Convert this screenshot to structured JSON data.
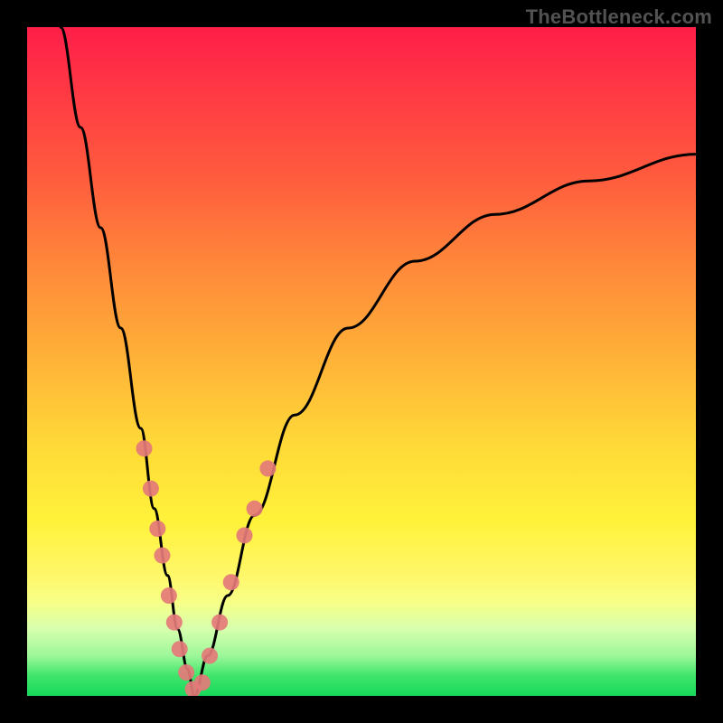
{
  "watermark": "TheBottleneck.com",
  "colors": {
    "gradient_top": "#ff1e49",
    "gradient_mid": "#ffd838",
    "gradient_bottom": "#16d95b",
    "curve": "#000000",
    "marker_fill": "#e47a7a",
    "marker_stroke": "#d46666"
  },
  "chart_data": {
    "type": "line",
    "title": "",
    "xlabel": "",
    "ylabel": "",
    "ylim": [
      0,
      100
    ],
    "xlim": [
      0,
      100
    ],
    "notes": "V-shaped bottleneck curve on red-to-green gradient. Minimum near x≈25. Pink markers cluster on the lower portion of both arms where bottleneck % is low.",
    "series": [
      {
        "name": "bottleneck-left-arm",
        "x": [
          5,
          8,
          11,
          14,
          17,
          19,
          21,
          22.5,
          24,
          25
        ],
        "y": [
          100,
          85,
          70,
          55,
          40,
          28,
          18,
          10,
          4,
          0
        ]
      },
      {
        "name": "bottleneck-right-arm",
        "x": [
          25,
          27,
          30,
          34,
          40,
          48,
          58,
          70,
          84,
          100
        ],
        "y": [
          0,
          6,
          15,
          27,
          42,
          55,
          65,
          72,
          77,
          81
        ]
      }
    ],
    "markers": [
      {
        "x": 17.5,
        "y": 37
      },
      {
        "x": 18.5,
        "y": 31
      },
      {
        "x": 19.5,
        "y": 25
      },
      {
        "x": 20.2,
        "y": 21
      },
      {
        "x": 21.2,
        "y": 15
      },
      {
        "x": 22.0,
        "y": 11
      },
      {
        "x": 22.8,
        "y": 7
      },
      {
        "x": 23.8,
        "y": 3.5
      },
      {
        "x": 24.8,
        "y": 1
      },
      {
        "x": 26.2,
        "y": 2
      },
      {
        "x": 27.3,
        "y": 6
      },
      {
        "x": 28.8,
        "y": 11
      },
      {
        "x": 30.5,
        "y": 17
      },
      {
        "x": 32.5,
        "y": 24
      },
      {
        "x": 34.0,
        "y": 28
      },
      {
        "x": 36.0,
        "y": 34
      }
    ]
  }
}
